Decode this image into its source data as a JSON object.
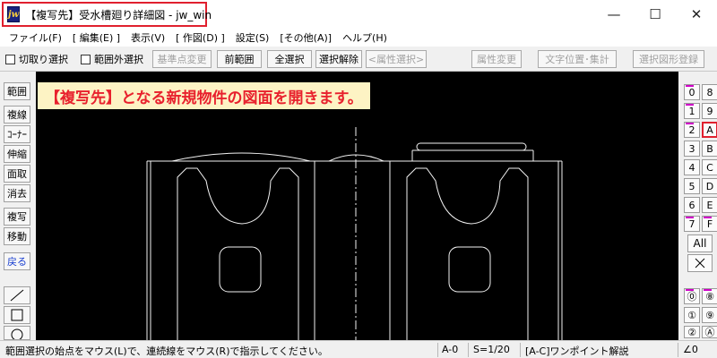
{
  "window": {
    "title": "【複写先】受水槽廻り詳細図 - jw_win",
    "app_icon": "jw",
    "minimize": "—",
    "maximize": "☐",
    "close": "✕"
  },
  "menu": [
    "ファイル(F)",
    "[ 編集(E) ]",
    "表示(V)",
    "[ 作図(D) ]",
    "設定(S)",
    "[その他(A)]",
    "ヘルプ(H)"
  ],
  "toolbar": {
    "checkbox1_label": "切取り選択",
    "checkbox2_label": "範囲外選択",
    "base_point_change": "基準点変更",
    "prev_range": "前範囲",
    "select_all": "全選択",
    "deselect": "選択解除",
    "attr_select": "<属性選択>",
    "attr_change": "属性変更",
    "text_pos_sum": "文字位置･集計",
    "register_shape": "選択図形登録"
  },
  "left_palette": [
    "範囲",
    "複線",
    "ｺｰﾅｰ",
    "伸縮",
    "面取",
    "消去",
    "複写",
    "移動",
    "戻る"
  ],
  "canvas": {
    "instruction": "【複写先】となる新規物件の図面を開きます。"
  },
  "layers": {
    "groups_left": [
      "0",
      "1",
      "2",
      "3",
      "4",
      "5",
      "6",
      "7"
    ],
    "groups_right": [
      "8",
      "9",
      "A",
      "B",
      "C",
      "D",
      "E",
      "F"
    ],
    "selected": "A",
    "all_label": "All",
    "circle_row1": [
      "⓪",
      "⑧"
    ],
    "circle_row2": [
      "①",
      "⑨"
    ],
    "circle_row3": [
      "②",
      "Ⓐ"
    ]
  },
  "status": {
    "message": "範囲選択の始点をマウス(L)で、連続線をマウス(R)で指示してください。",
    "layer": "A-0",
    "scale": "S=1/20",
    "help": "[A-C]ワンポイント解説",
    "angle": "∠0"
  }
}
